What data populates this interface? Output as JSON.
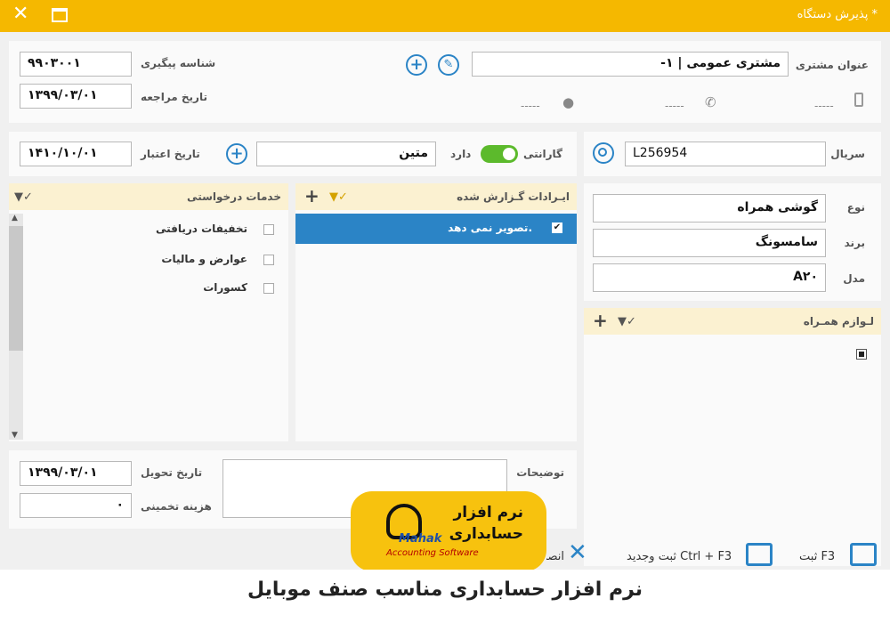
{
  "window": {
    "title": "پذیرش دستگاه *"
  },
  "customer": {
    "tracking_label": "شناسه پیگیری",
    "tracking_value": "۹۹۰۳۰۰۱",
    "ref_date_label": "تاریخ مراجعه",
    "ref_date_value": "۱۳۹۹/۰۳/۰۱",
    "title_label": "عنوان مشتری",
    "title_value": "-۱ | مشتری عمومی",
    "mobile": "-----",
    "phone": "-----",
    "address": "-----"
  },
  "warranty": {
    "expiry_label": "تاریخ اعتبار",
    "expiry_value": "۱۴۱۰/۱۰/۰۱",
    "company_value": "متین",
    "has_label": "دارد",
    "warranty_label": "گارانتی"
  },
  "device": {
    "serial_label": "سریال",
    "serial_value": "L256954",
    "type_label": "نوع",
    "type_value": "گوشی همراه",
    "brand_label": "برند",
    "brand_value": "سامسونگ",
    "model_label": "مدل",
    "model_value": "A۲۰"
  },
  "services": {
    "title": "خدمات درخواستی",
    "items": [
      "تخفیفات دریافتی",
      "عوارض و مالیات",
      "کسورات"
    ]
  },
  "issues": {
    "title": "ایـرادات گـزارش شده",
    "items": [
      "تصویر نمی دهد."
    ]
  },
  "accessories": {
    "title": "لـوازم همـراه"
  },
  "bottom": {
    "delivery_label": "تاریخ تحویل",
    "delivery_value": "۱۳۹۹/۰۳/۰۱",
    "cost_label": "هزینه تخمینی",
    "cost_value": "۰",
    "notes_label": "توضیحات"
  },
  "footer": {
    "save_label": "ثبت F3",
    "save_new_label": "ثبت وجدید Ctrl + F3",
    "cancel_label": "انصراف"
  },
  "logo": {
    "name_line1": "نرم افزار",
    "name_line2": "حسابداری",
    "brand": "Mahak",
    "tagline": "Accounting Software"
  },
  "caption": "نرم افزار حسابداری مناسب صنف موبایل",
  "colors": {
    "accent": "#f5b800",
    "selection": "#2b84c6",
    "toggle_on": "#5cba2c"
  }
}
